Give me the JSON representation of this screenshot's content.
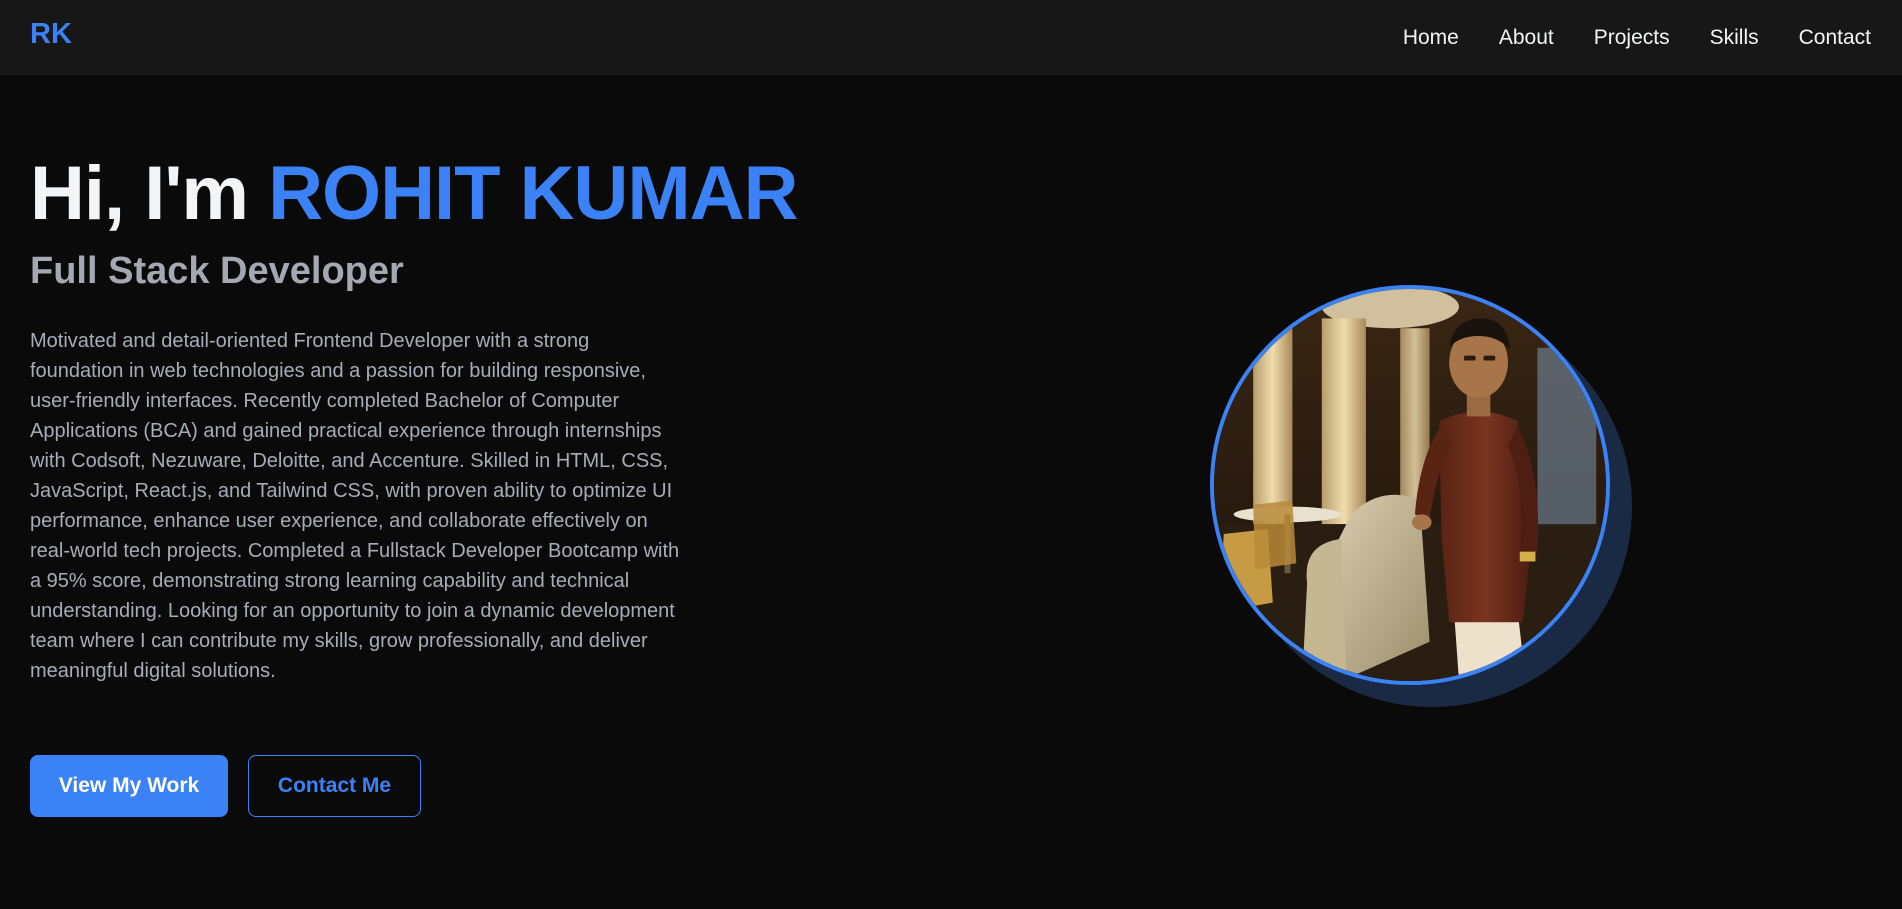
{
  "nav": {
    "logo": "RK",
    "links": [
      "Home",
      "About",
      "Projects",
      "Skills",
      "Contact"
    ]
  },
  "hero": {
    "greeting": "Hi, I'm",
    "name": "ROHIT KUMAR",
    "subtitle": "Full Stack Developer",
    "bio": "Motivated and detail-oriented Frontend Developer with a strong foundation in web technologies and a passion for building responsive, user-friendly interfaces. Recently completed Bachelor of Computer Applications (BCA) and gained practical experience through internships with Codsoft, Nezuware, Deloitte, and Accenture. Skilled in HTML, CSS, JavaScript, React.js, and Tailwind CSS, with proven ability to optimize UI performance, enhance user experience, and collaborate effectively on real-world tech projects. Completed a Fullstack Developer Bootcamp with a 95% score, demonstrating strong learning capability and technical understanding. Looking for an opportunity to join a dynamic development team where I can contribute my skills, grow professionally, and deliver meaningful digital solutions.",
    "primary_button": "View My Work",
    "secondary_button": "Contact Me"
  },
  "colors": {
    "accent": "#3b82f6",
    "background": "#0a0a0b",
    "navbar": "#171717"
  }
}
